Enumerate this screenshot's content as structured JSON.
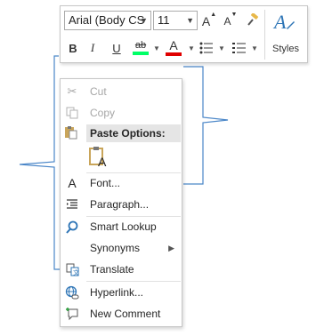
{
  "toolbar": {
    "font_name": "Arial (Body CS",
    "font_size": "11",
    "grow_font": "A",
    "shrink_font": "A",
    "bold": "B",
    "italic": "I",
    "underline": "U",
    "highlight_glyph": "ab",
    "font_color_glyph": "A",
    "styles_label": "Styles",
    "highlight_color": "#00b050",
    "font_color": "#e00000",
    "styles_color": "#2e75b6"
  },
  "menu": {
    "cut": "Cut",
    "copy": "Copy",
    "paste_options": "Paste Options:",
    "font": "Font...",
    "paragraph": "Paragraph...",
    "smart_lookup": "Smart Lookup",
    "synonyms": "Synonyms",
    "translate": "Translate",
    "hyperlink": "Hyperlink...",
    "new_comment": "New Comment"
  },
  "colors": {
    "bracket": "#4a86c8",
    "menu_border": "#c6c6c6"
  }
}
